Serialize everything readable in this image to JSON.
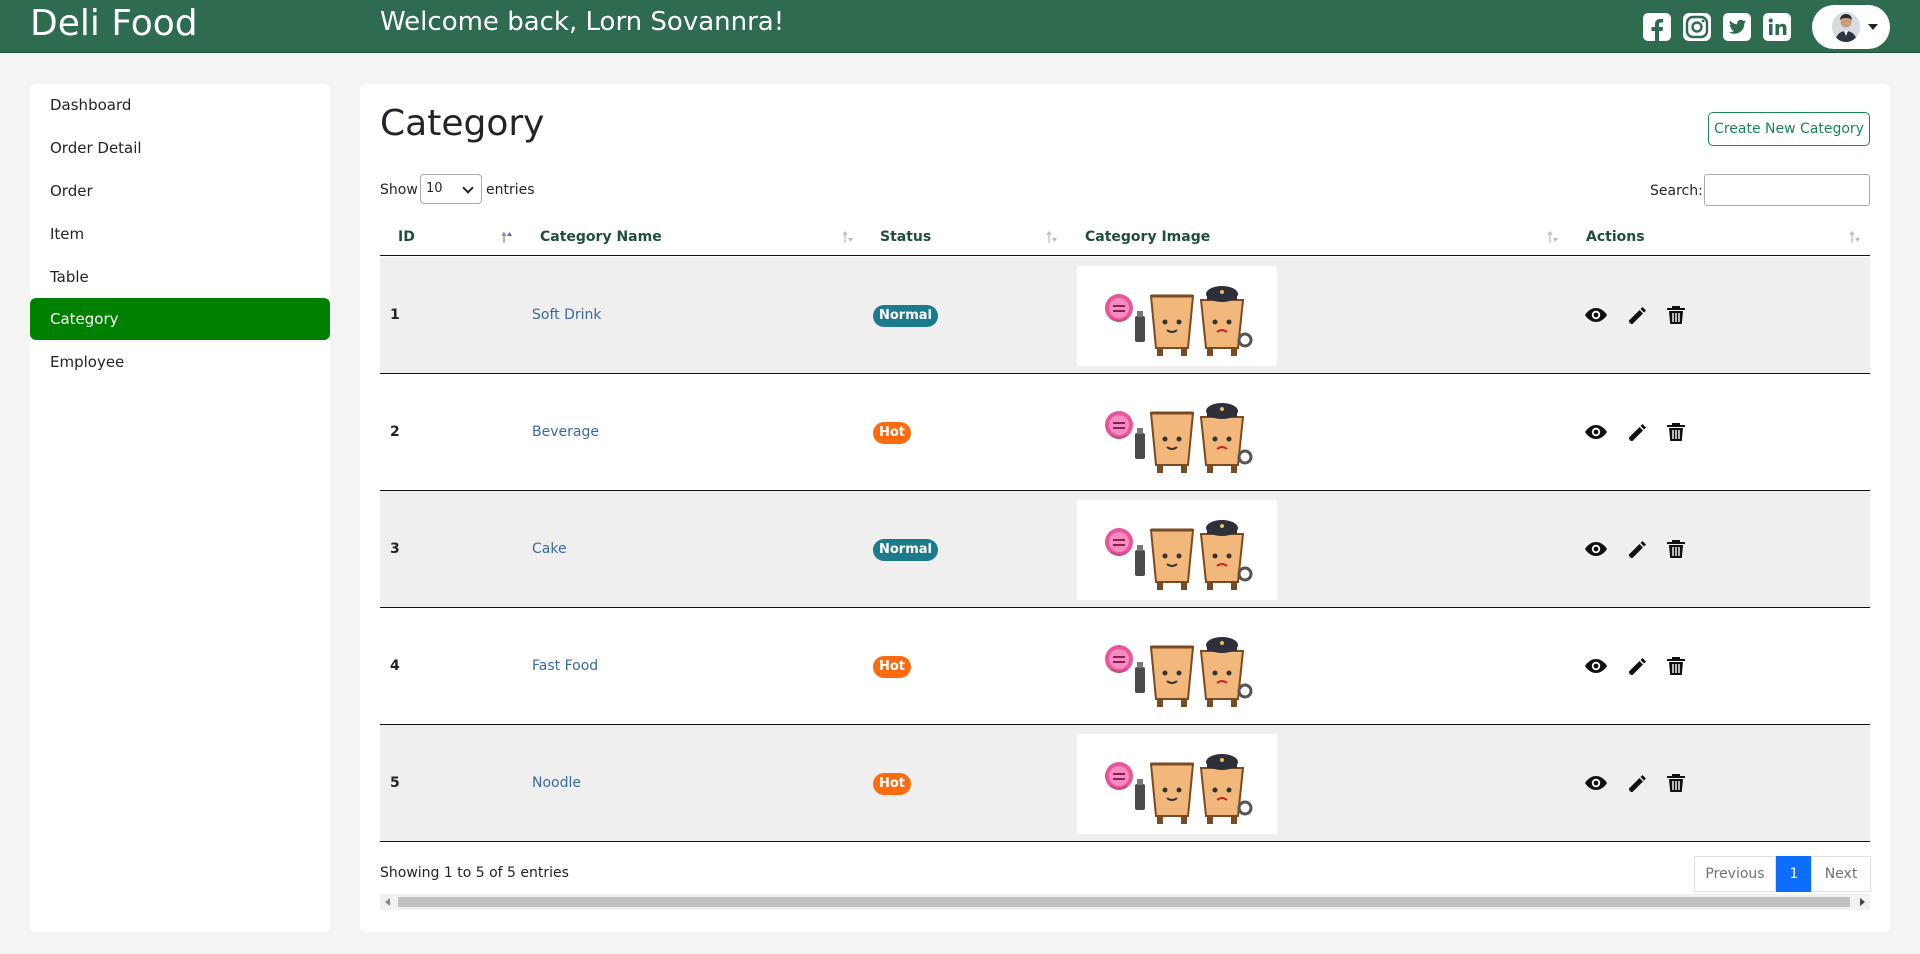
{
  "header": {
    "brand": "Deli Food",
    "welcome": "Welcome back, Lorn Sovannra!",
    "social_icons": [
      "facebook-icon",
      "instagram-icon",
      "twitter-icon",
      "linkedin-icon"
    ],
    "bg_color": "#2e6b4f"
  },
  "sidebar": {
    "items": [
      {
        "label": "Dashboard"
      },
      {
        "label": "Order Detail"
      },
      {
        "label": "Order"
      },
      {
        "label": "Item"
      },
      {
        "label": "Table"
      },
      {
        "label": "Category",
        "active": true
      },
      {
        "label": "Employee"
      }
    ],
    "active_color": "#008000"
  },
  "main": {
    "title": "Category",
    "create_button": "Create New Category",
    "show_label": "Show",
    "page_length": "10",
    "entries_label": "entries",
    "search_label": "Search:",
    "search_value": "",
    "columns": [
      "ID",
      "Category Name",
      "Status",
      "Category Image",
      "Actions"
    ],
    "rows": [
      {
        "id": "1",
        "name": "Soft Drink",
        "status": "Normal"
      },
      {
        "id": "2",
        "name": "Beverage",
        "status": "Hot"
      },
      {
        "id": "3",
        "name": "Cake",
        "status": "Normal"
      },
      {
        "id": "4",
        "name": "Fast Food",
        "status": "Hot"
      },
      {
        "id": "5",
        "name": "Noodle",
        "status": "Hot"
      }
    ],
    "status_colors": {
      "Normal": "#1b7a8c",
      "Hot": "#fd6b10"
    },
    "row_actions": [
      "eye-icon",
      "pencil-icon",
      "trash-icon"
    ],
    "info": "Showing 1 to 5 of 5 entries",
    "pagination": {
      "previous": "Previous",
      "current": "1",
      "next": "Next"
    }
  }
}
